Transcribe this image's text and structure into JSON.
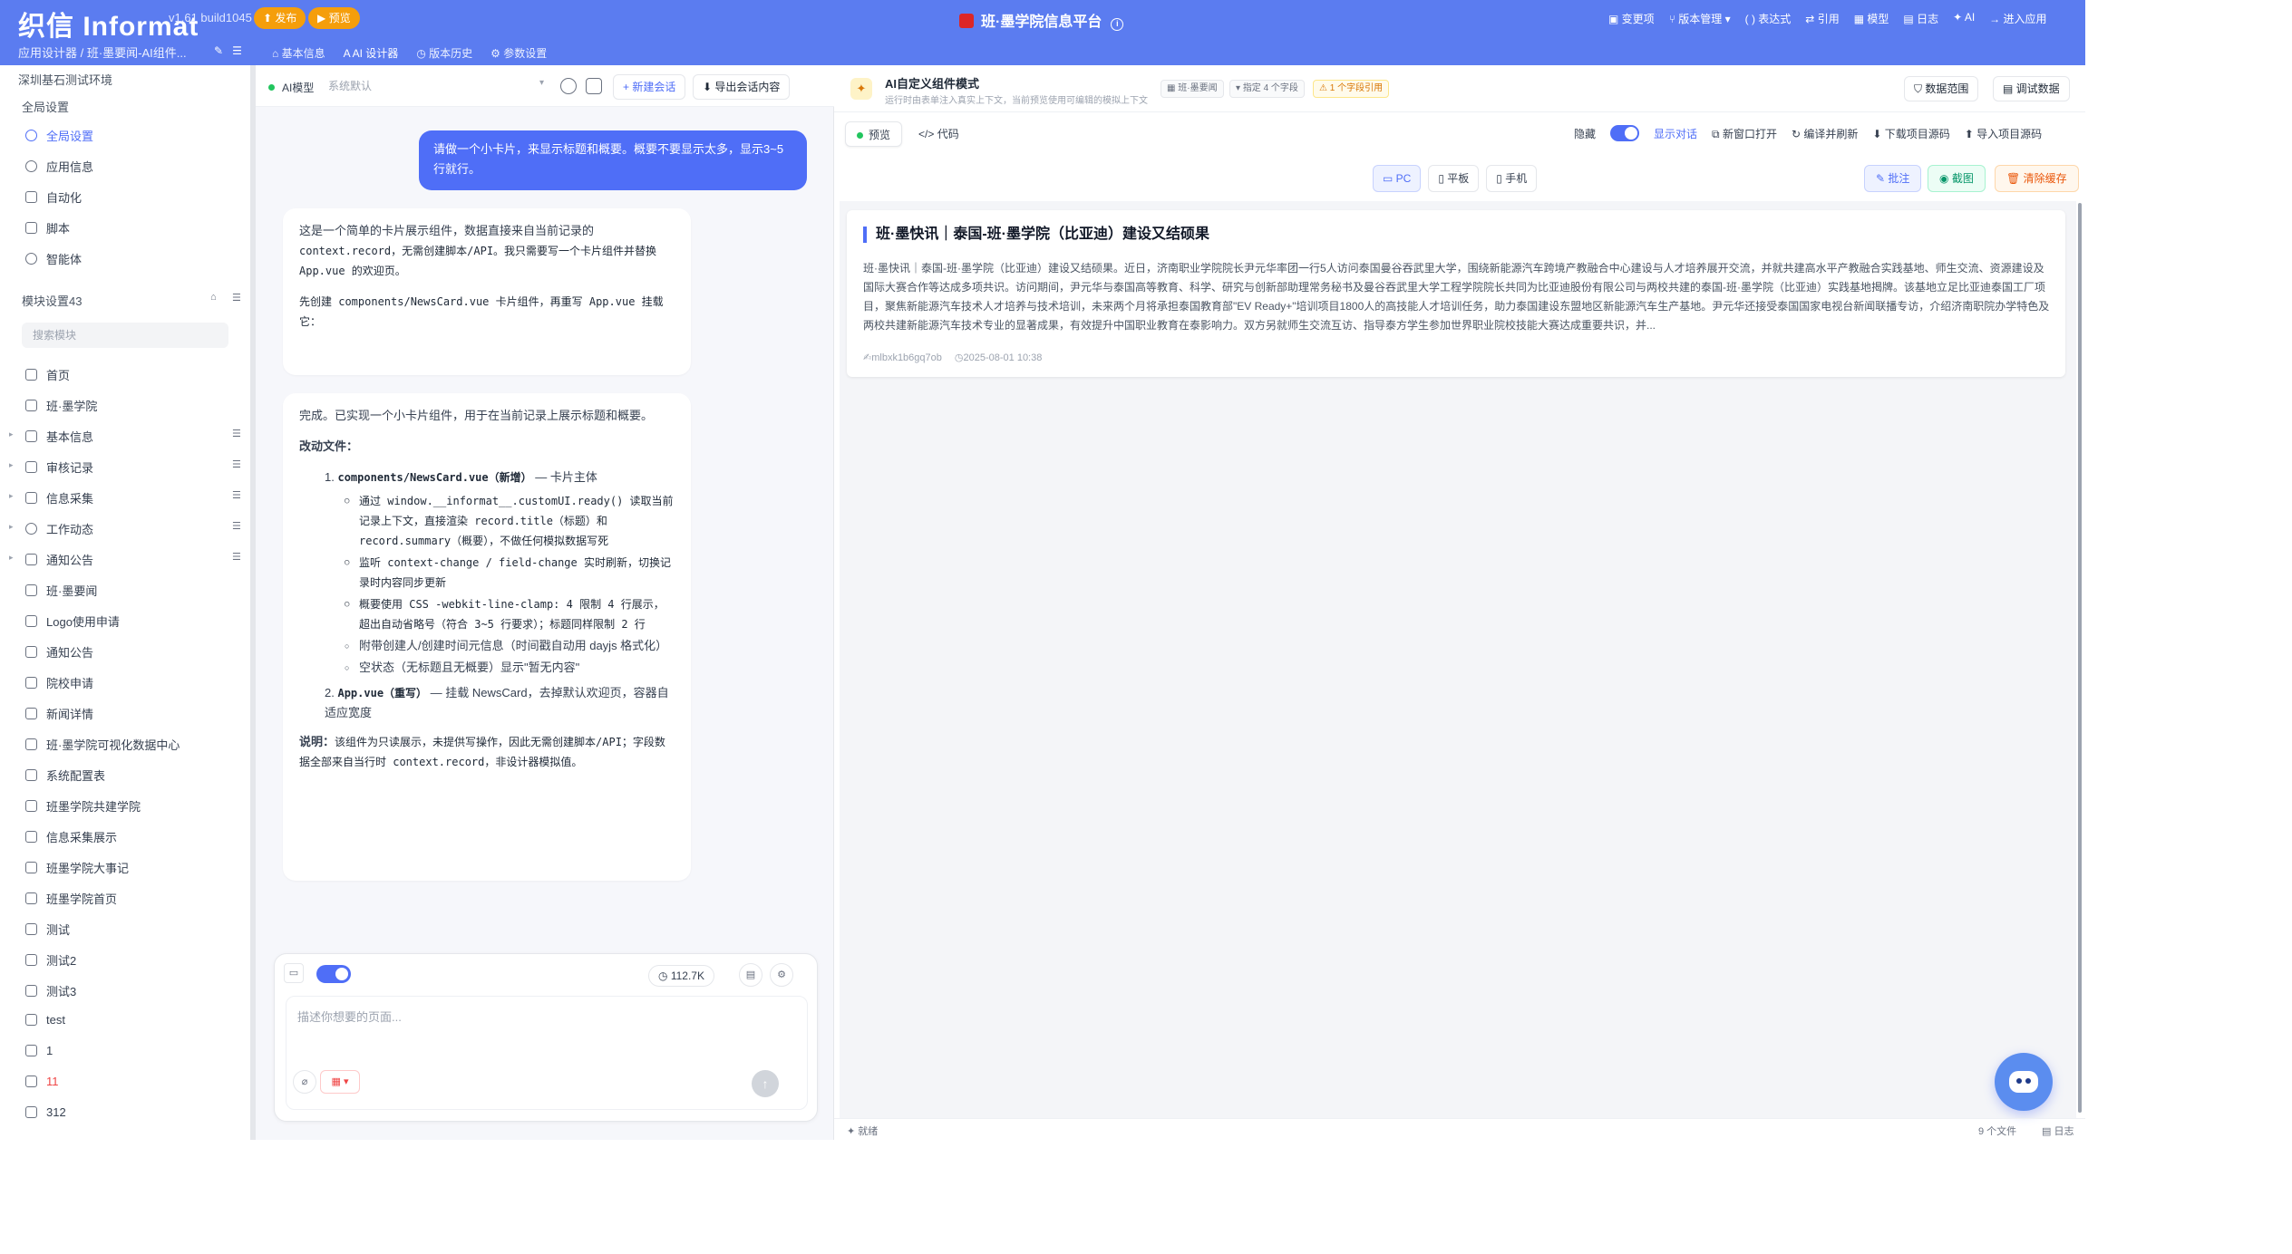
{
  "topbar": {
    "logo": "织信 Informat",
    "version": "v1.61 build1045",
    "publish_label": "发布",
    "preview_label": "预览",
    "title": "班·墨学院信息平台",
    "actions": [
      "变更项",
      "版本管理",
      "表达式",
      "引用",
      "模型",
      "日志",
      "AI",
      "进入应用"
    ],
    "breadcrumb": "应用设计器 / 班·墨要闻-AI组件...",
    "tabs": [
      {
        "label": "基本信息",
        "active": false
      },
      {
        "label": "AI 设计器",
        "active": true
      },
      {
        "label": "版本历史",
        "active": false
      },
      {
        "label": "参数设置",
        "active": false
      }
    ]
  },
  "sidebar": {
    "env": "深圳基石测试环境",
    "global_section": "全局设置",
    "global_items": [
      {
        "label": "全局设置",
        "active": true
      },
      {
        "label": "应用信息"
      },
      {
        "label": "自动化"
      },
      {
        "label": "脚本"
      },
      {
        "label": "智能体"
      }
    ],
    "module_section": "模块设置43",
    "search_placeholder": "搜索模块",
    "modules": [
      {
        "label": "首页"
      },
      {
        "label": "班·墨学院"
      },
      {
        "label": "基本信息",
        "expandable": true
      },
      {
        "label": "审核记录",
        "expandable": true
      },
      {
        "label": "信息采集",
        "expandable": true
      },
      {
        "label": "工作动态",
        "expandable": true
      },
      {
        "label": "通知公告",
        "expandable": true
      },
      {
        "label": "班·墨要闻"
      },
      {
        "label": "Logo使用申请"
      },
      {
        "label": "通知公告"
      },
      {
        "label": "院校申请"
      },
      {
        "label": "新闻详情"
      },
      {
        "label": "班·墨学院可视化数据中心"
      },
      {
        "label": "系统配置表"
      },
      {
        "label": "班墨学院共建学院"
      },
      {
        "label": "信息采集展示"
      },
      {
        "label": "班墨学院大事记"
      },
      {
        "label": "班墨学院首页"
      },
      {
        "label": "测试"
      },
      {
        "label": "测试2"
      },
      {
        "label": "测试3"
      },
      {
        "label": "test"
      },
      {
        "label": "1"
      },
      {
        "label": "11",
        "red": true
      },
      {
        "label": "312"
      }
    ]
  },
  "chat": {
    "model_label": "AI模型",
    "model_value": "系统默认",
    "new_chat": "新建会话",
    "export": "导出会话内容",
    "user_msg": "请做一个小卡片，来显示标题和概要。概要不要显示太多，显示3~5行就行。",
    "ai1_p1": "这是一个简单的卡片展示组件，数据直接来自当前记录的",
    "ai1_p1b": "context.record，无需创建脚本/API。我只需要写一个卡片组件并替换 App.vue 的欢迎页。",
    "ai1_p2": "先创建 components/NewsCard.vue 卡片组件，再重写 App.vue 挂载它：",
    "ai2_intro": "完成。已实现一个小卡片组件，用于在当前记录上展示标题和概要。",
    "ai2_changes": "改动文件：",
    "ai2_file1": "components/NewsCard.vue（新增）",
    "ai2_file1_suffix": " — 卡片主体",
    "ai2_bullets": [
      "通过 window.__informat__.customUI.ready() 读取当前记录上下文，直接渲染 record.title（标题）和 record.summary（概要），不做任何模拟数据写死",
      "监听 context-change / field-change 实时刷新，切换记录时内容同步更新",
      "概要使用 CSS -webkit-line-clamp: 4 限制 4 行展示，超出自动省略号（符合 3~5 行要求）；标题同样限制 2 行",
      "附带创建人/创建时间元信息（时间戳自动用 dayjs 格式化）",
      "空状态（无标题且无概要）显示\"暂无内容\""
    ],
    "ai2_file2": "App.vue（重写）",
    "ai2_file2_suffix": " — 挂载 NewsCard，去掉默认欢迎页，容器自适应宽度",
    "ai2_note_label": "说明：",
    "ai2_note": "该组件为只读展示，未提供写操作，因此无需创建脚本/API；字段数据全部来自当行时 context.record，非设计器模拟值。",
    "token_count": "112.7K",
    "composer_placeholder": "描述你想要的页面..."
  },
  "preview": {
    "header_title": "AI自定义组件模式",
    "header_sub": "运行时由表单注入真实上下文，当前预览使用可编辑的模拟上下文",
    "tags": [
      "班·墨要闻",
      "指定 4 个字段",
      "1 个字段引用"
    ],
    "data_scope": "数据范围",
    "debug_data": "调试数据",
    "tab_preview": "预览",
    "tab_code": "代码",
    "hide_label": "隐藏",
    "show_chat": "显示对话",
    "open_window": "新窗口打开",
    "compile_refresh": "编译并刷新",
    "download_src": "下载项目源码",
    "import_src": "导入项目源码",
    "devices": [
      "PC",
      "平板",
      "手机"
    ],
    "annotate": "批注",
    "screenshot": "截图",
    "clear_cache": "清除缓存",
    "card_title": "班·墨快讯｜泰国-班·墨学院（比亚迪）建设又结硕果",
    "card_summary": "班·墨快讯｜泰国-班·墨学院（比亚迪）建设又结硕果。近日，济南职业学院院长尹元华率团一行5人访问泰国曼谷吞武里大学，围绕新能源汽车跨境产教融合中心建设与人才培养展开交流，并就共建高水平产教融合实践基地、师生交流、资源建设及国际大赛合作等达成多项共识。访问期间，尹元华与泰国高等教育、科学、研究与创新部助理常务秘书及曼谷吞武里大学工程学院院长共同为比亚迪股份有限公司与两校共建的泰国-班·墨学院（比亚迪）实践基地揭牌。该基地立足比亚迪泰国工厂项目，聚焦新能源汽车技术人才培养与技术培训，未来两个月将承担泰国教育部\"EV Ready+\"培训项目1800人的高技能人才培训任务，助力泰国建设东盟地区新能源汽车生产基地。尹元华还接受泰国国家电视台新闻联播专访，介绍济南职院办学特色及两校共建新能源汽车技术专业的显著成果，有效提升中国职业教育在泰影响力。双方另就师生交流互访、指导泰方学生参加世界职业院校技能大赛达成重要共识，并...",
    "card_author": "mlbxk1b6gq7ob",
    "card_time": "2025-08-01 10:38",
    "status_ready": "就绪",
    "file_count": "9 个文件",
    "log": "日志"
  },
  "colors": {
    "brand": "#5b7cf0",
    "accent": "#4f6ef7",
    "warn": "#f59e0b"
  }
}
